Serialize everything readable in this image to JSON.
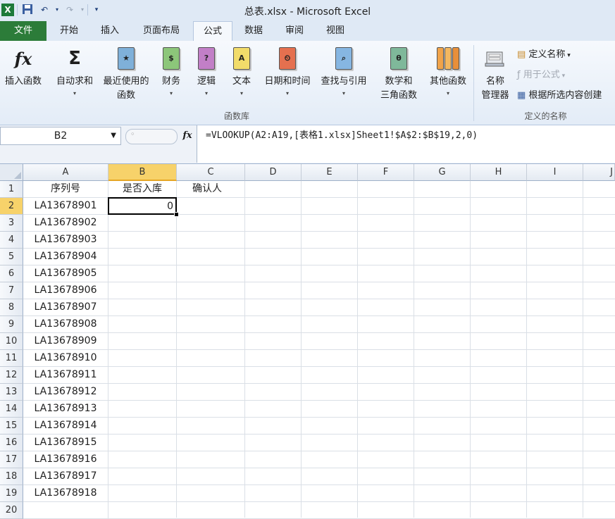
{
  "window": {
    "title": "总表.xlsx - Microsoft Excel"
  },
  "qat": {
    "icons": [
      "excel-icon",
      "save-icon",
      "undo-icon",
      "redo-icon",
      "customize-icon"
    ]
  },
  "tabs": [
    "文件",
    "开始",
    "插入",
    "页面布局",
    "公式",
    "数据",
    "审阅",
    "视图"
  ],
  "active_tab": "公式",
  "ribbon": {
    "library_group": {
      "label": "函数库",
      "buttons": [
        {
          "label": "插入函数",
          "symbol": "fx"
        },
        {
          "label": "自动求和",
          "symbol": "Σ"
        },
        {
          "label": "最近使用的\n函数",
          "symbol": "★"
        },
        {
          "label": "财务",
          "symbol": "$"
        },
        {
          "label": "逻辑",
          "symbol": "?"
        },
        {
          "label": "文本",
          "symbol": "A"
        },
        {
          "label": "日期和时间",
          "symbol": "⏲"
        },
        {
          "label": "查找与引用",
          "symbol": "⌕"
        },
        {
          "label": "数学和\n三角函数",
          "symbol": "θ"
        },
        {
          "label": "其他函数",
          "symbol": ""
        }
      ]
    },
    "names_group": {
      "label": "定义的名称",
      "manager_label": "名称\n管理器",
      "define_name": "定义名称",
      "use_in_formula": "用于公式",
      "create_from_selection": "根据所选内容创建"
    }
  },
  "formula_bar": {
    "name_box": "B2",
    "fx_label": "fx",
    "formula": "=VLOOKUP(A2:A19,[表格1.xlsx]Sheet1!$A$2:$B$19,2,0)"
  },
  "sheet": {
    "columns": [
      "A",
      "B",
      "C",
      "D",
      "E",
      "F",
      "G",
      "H",
      "I",
      "J"
    ],
    "selected_column": "B",
    "selected_row": 2,
    "headers": {
      "A": "序列号",
      "B": "是否入库",
      "C": "确认人"
    },
    "b2_value": "0",
    "serials": [
      "LA13678901",
      "LA13678902",
      "LA13678903",
      "LA13678904",
      "LA13678905",
      "LA13678906",
      "LA13678907",
      "LA13678908",
      "LA13678909",
      "LA13678910",
      "LA13678911",
      "LA13678912",
      "LA13678913",
      "LA13678914",
      "LA13678915",
      "LA13678916",
      "LA13678917",
      "LA13678918"
    ],
    "row_numbers": [
      "1",
      "2",
      "3",
      "4",
      "5",
      "6",
      "7",
      "8",
      "9",
      "10",
      "11",
      "12",
      "13",
      "14",
      "15",
      "16",
      "17",
      "18",
      "19",
      "20"
    ]
  },
  "colors": {
    "accent": "#2c7c39",
    "selection": "#f7d26a",
    "ribbon": "#dfe9f5"
  }
}
